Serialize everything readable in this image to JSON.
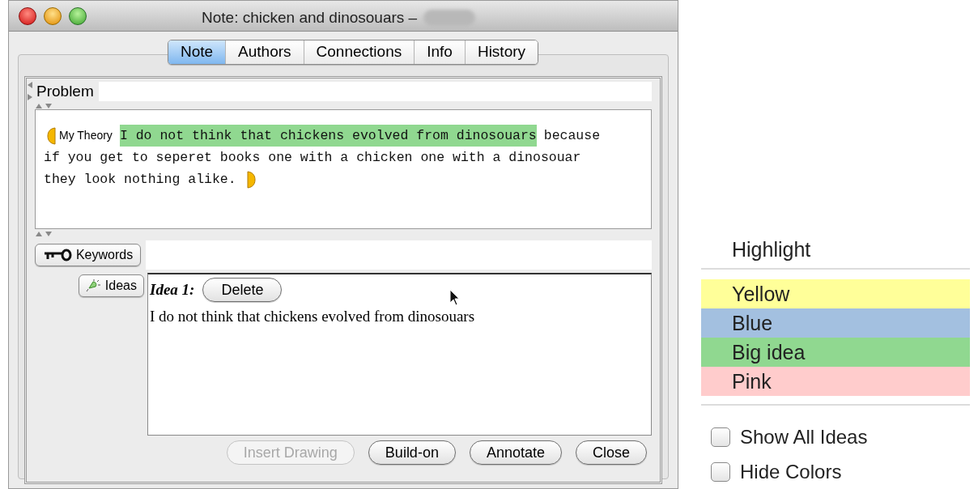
{
  "window": {
    "title": "Note: chicken and dinosouars –"
  },
  "tabs": [
    {
      "label": "Note",
      "selected": true
    },
    {
      "label": "Authors",
      "selected": false
    },
    {
      "label": "Connections",
      "selected": false
    },
    {
      "label": "Info",
      "selected": false
    },
    {
      "label": "History",
      "selected": false
    }
  ],
  "problem": {
    "label": "Problem"
  },
  "note": {
    "scaffold": "My Theory",
    "lines": [
      {
        "segments": [
          {
            "text": "I do not think that chickens evolved from dinosouars",
            "color": "#90d890"
          },
          {
            "text": "because"
          }
        ]
      },
      {
        "segments": [
          {
            "text": "if you get to seperet books one with a chicken one with a dinosouar"
          }
        ]
      },
      {
        "segments": [
          {
            "text": "they look nothing alike."
          }
        ]
      }
    ]
  },
  "keywords_button": "Keywords",
  "ideas_button": "Ideas",
  "idea": {
    "title": "Idea 1:",
    "delete_button": "Delete",
    "text": "I do not think that chickens evolved from dinosouars"
  },
  "buttons": [
    {
      "label": "Insert Drawing",
      "disabled": true
    },
    {
      "label": "Build-on",
      "disabled": false
    },
    {
      "label": "Annotate",
      "disabled": false
    },
    {
      "label": "Close",
      "disabled": false
    }
  ],
  "highlight_menu": {
    "title": "Highlight",
    "items": [
      {
        "label": "Yellow",
        "color": "#ffff99"
      },
      {
        "label": "Blue",
        "color": "#a3c0e0"
      },
      {
        "label": "Big idea",
        "color": "#90d890"
      },
      {
        "label": "Pink",
        "color": "#ffcccc"
      }
    ],
    "options": [
      {
        "label": "Show All Ideas",
        "checked": false
      },
      {
        "label": "Hide Colors",
        "checked": false
      }
    ]
  }
}
